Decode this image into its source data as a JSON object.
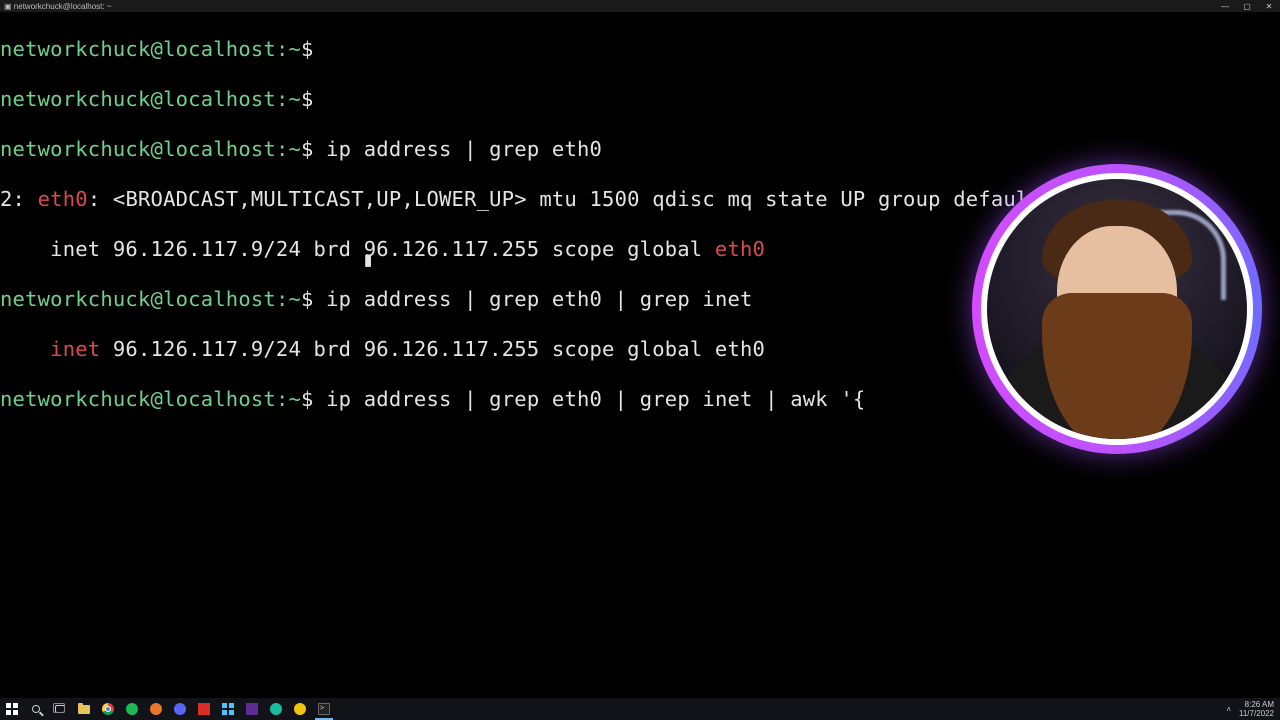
{
  "window": {
    "title": "networkchuck@localhost: ~",
    "controls": {
      "min": "—",
      "max": "▢",
      "close": "✕"
    }
  },
  "prompt": {
    "user": "networkchuck",
    "at": "@",
    "host": "localhost",
    "sep1": ":",
    "path": "~",
    "dollar": "$"
  },
  "lines": {
    "l1_cmd": "",
    "l2_cmd": "",
    "l3_cmd": "ip address | grep eth0",
    "l4_a": "2: ",
    "l4_b": "eth0",
    "l4_c": ": <BROADCAST,MULTICAST,UP,LOWER_UP> mtu 1500 qdisc mq state UP group default qlen 1000",
    "l5_a": "    inet 96.126.117.9/24 brd 96.126.117.255 scope global ",
    "l5_b": "eth0",
    "l6_cmd": "ip address | grep eth0 | grep inet",
    "l7_a": "    ",
    "l7_b": "inet",
    "l7_c": " 96.126.117.9/24 brd 96.126.117.255 scope global eth0",
    "l8_cmd": "ip address | grep eth0 | grep inet | awk '{"
  },
  "cursor_glyph": "▮",
  "taskbar": {
    "icons": [
      "start",
      "search",
      "task-view",
      "file-explorer",
      "chrome",
      "spotify",
      "app-orange",
      "discord",
      "app-red",
      "app-grid",
      "vscode",
      "obs",
      "app-yellow",
      "terminal"
    ],
    "tray": {
      "chevron": "˄",
      "time": "8:26 AM",
      "date": "11/7/2022"
    }
  }
}
